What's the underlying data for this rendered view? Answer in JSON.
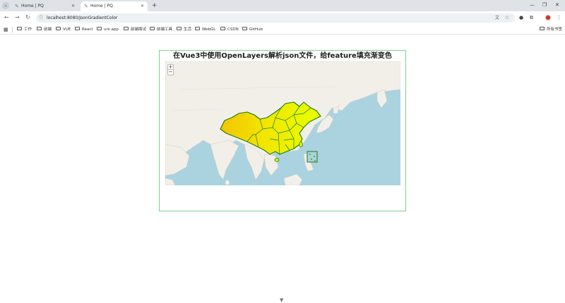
{
  "browser": {
    "tabs": [
      {
        "title": "Home | PQ",
        "active": false
      },
      {
        "title": "Home | PQ",
        "active": true
      }
    ],
    "new_tab_label": "+",
    "url": "localhost:8080/JsonGradientColor",
    "bookmarks": [
      "工作",
      "前端",
      "VUE",
      "React",
      "uni-app",
      "前端面试",
      "前端工具",
      "生活",
      "WebGL",
      "CSDN",
      "GitHub"
    ],
    "all_bookmarks_label": "所有书签"
  },
  "page": {
    "title": "在Vue3中使用OpenLayers解析json文件，给feature填充渐变色",
    "zoom_in_label": "+",
    "zoom_out_label": "−"
  },
  "colors": {
    "panel_border": "#7fd08f",
    "ocean": "#aad3df",
    "land": "#f2efe9",
    "feature_stroke": "#1a7a1a",
    "gradient_start": "#f3c500",
    "gradient_end": "#e6ff00"
  }
}
